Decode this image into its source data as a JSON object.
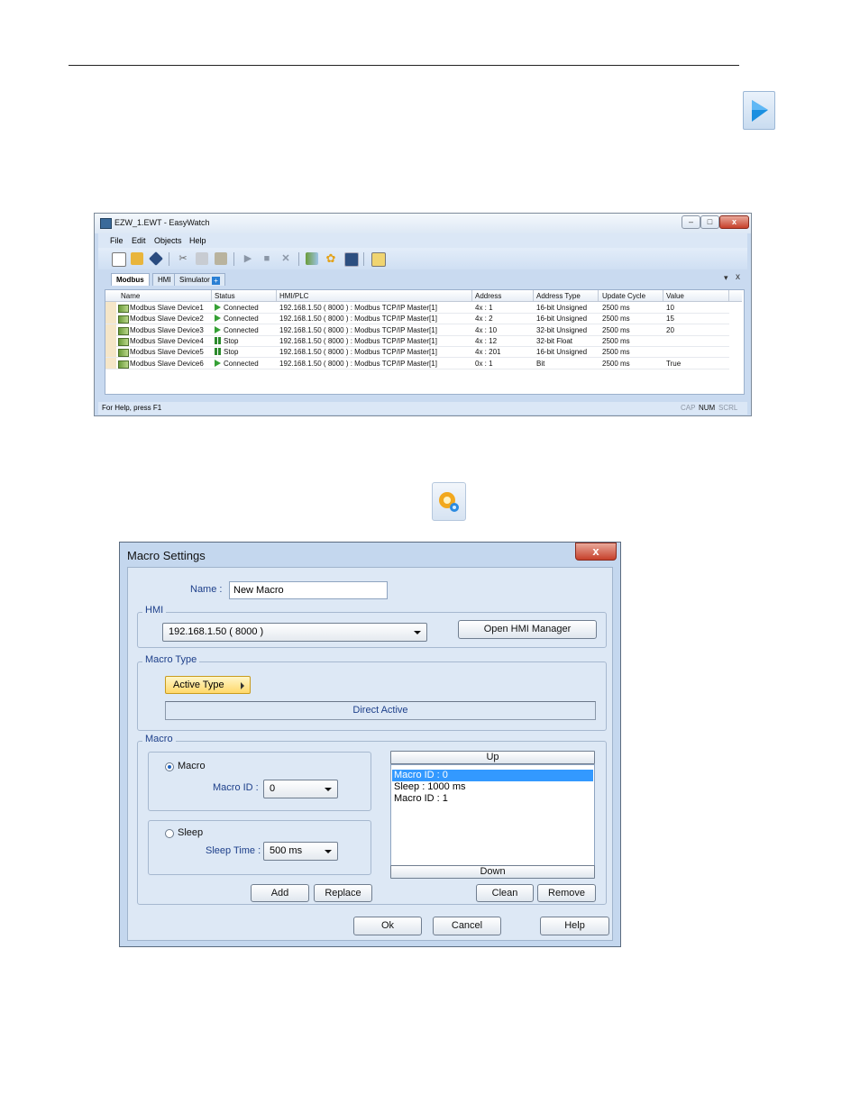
{
  "easywatch": {
    "title": "EZW_1.EWT - EasyWatch",
    "win_min": "–",
    "win_max": "□",
    "win_close": "x",
    "menu": [
      "File",
      "Edit",
      "Objects",
      "Help"
    ],
    "tabs": [
      "Modbus",
      "HMI",
      "Simulator"
    ],
    "tabs_panel_pin": "▾",
    "tabs_panel_close": "x",
    "columns": [
      "Name",
      "Status",
      "HMI/PLC",
      "Address",
      "Address Type",
      "Update Cycle",
      "Value"
    ],
    "rows": [
      {
        "name": "Modbus Slave Device1",
        "status": "Connected",
        "hmi": "192.168.1.50 ( 8000 )  : Modbus TCP/IP Master[1]",
        "address": "4x : 1",
        "type": "16-bit Unsigned",
        "cycle": "2500 ms",
        "value": "10"
      },
      {
        "name": "Modbus Slave Device2",
        "status": "Connected",
        "hmi": "192.168.1.50 ( 8000 )  : Modbus TCP/IP Master[1]",
        "address": "4x : 2",
        "type": "16-bit Unsigned",
        "cycle": "2500 ms",
        "value": "15"
      },
      {
        "name": "Modbus Slave Device3",
        "status": "Connected",
        "hmi": "192.168.1.50 ( 8000 )  : Modbus TCP/IP Master[1]",
        "address": "4x : 10",
        "type": "32-bit Unsigned",
        "cycle": "2500 ms",
        "value": "20"
      },
      {
        "name": "Modbus Slave Device4",
        "status": "Stop",
        "hmi": "192.168.1.50 ( 8000 )  : Modbus TCP/IP Master[1]",
        "address": "4x : 12",
        "type": "32-bit Float",
        "cycle": "2500 ms",
        "value": ""
      },
      {
        "name": "Modbus Slave Device5",
        "status": "Stop",
        "hmi": "192.168.1.50 ( 8000 )  : Modbus TCP/IP Master[1]",
        "address": "4x : 201",
        "type": "16-bit Unsigned",
        "cycle": "2500 ms",
        "value": ""
      },
      {
        "name": "Modbus Slave Device6",
        "status": "Connected",
        "hmi": "192.168.1.50 ( 8000 )  : Modbus TCP/IP Master[1]",
        "address": "0x : 1",
        "type": "Bit",
        "cycle": "2500 ms",
        "value": "True"
      }
    ],
    "status_text": "For Help, press F1",
    "status_indicators": [
      "CAP",
      "NUM",
      "SCRL"
    ]
  },
  "macro": {
    "title": "Macro Settings",
    "close": "x",
    "name_label": "Name :",
    "name_value": "New Macro",
    "hmi_legend": "HMI",
    "hmi_value": "192.168.1.50 ( 8000 )",
    "open_hmi_manager": "Open HMI Manager",
    "macro_type_legend": "Macro Type",
    "active_type": "Active Type",
    "direct_active": "Direct Active",
    "macro_legend": "Macro",
    "radio_macro": "Macro",
    "macro_id_label": "Macro ID :",
    "macro_id_value": "0",
    "radio_sleep": "Sleep",
    "sleep_time_label": "Sleep Time :",
    "sleep_time_value": "500 ms",
    "up": "Up",
    "down": "Down",
    "list": [
      "Macro ID : 0",
      "Sleep : 1000 ms",
      "Macro ID : 1"
    ],
    "add": "Add",
    "replace": "Replace",
    "clean": "Clean",
    "remove": "Remove",
    "ok": "Ok",
    "cancel": "Cancel",
    "help": "Help"
  }
}
